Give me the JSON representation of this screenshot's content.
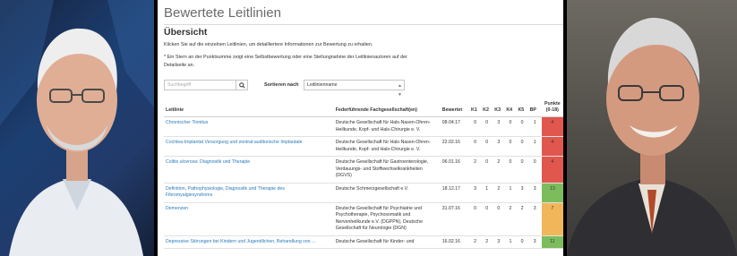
{
  "page": {
    "title": "Bewertete Leitlinien",
    "section_title": "Übersicht",
    "intro": "Klicken Sie auf die einzelnen Leitlinien, um detailliertere Informationen zur Bewertung zu erhalten.",
    "note": "* Ein Stern an der Punktsumme zeigt eine Selbstbewertung oder eine Stellungnahme der Leitlinienautoren auf der Detailseite an."
  },
  "search": {
    "placeholder": "Suchbegriff",
    "button_icon": "search-icon"
  },
  "sort": {
    "label": "Sortieren nach",
    "selected": "Leitlinienname"
  },
  "table": {
    "headers": {
      "leitlinie": "Leitlinie",
      "gesellschaft": "Federführende Fachgesellschaft(en)",
      "bewertet": "Bewertet",
      "k1": "K1",
      "k2": "K2",
      "k3": "K3",
      "k4": "K4",
      "k5": "K5",
      "bp": "BP",
      "punkte": "Punkte",
      "punkte_range": "(0-18)"
    },
    "rows": [
      {
        "title": "Chronischer Tinnitus",
        "society": "Deutsche Gesellschaft für Hals-Nasen-Ohren-Heilkunde, Kopf- und Hals-Chirurgie e. V.",
        "date": "08.04.17",
        "k1": "0",
        "k2": "0",
        "k3": "3",
        "k4": "0",
        "k5": "0",
        "bp": "1",
        "points": "4",
        "color": "#e1574d"
      },
      {
        "title": "Cochlea-Implantat Versorgung und zentral-auditorische Implantate",
        "society": "Deutsche Gesellschaft für Hals-Nasen-Ohren-Heilkunde, Kopf- und Hals-Chirurgie e. V.",
        "date": "22.02.16",
        "k1": "0",
        "k2": "0",
        "k3": "3",
        "k4": "0",
        "k5": "0",
        "bp": "1",
        "points": "4",
        "color": "#e1574d"
      },
      {
        "title": "Colitis ulcerosa: Diagnostik und Therapie",
        "society": "Deutsche Gesellschaft für Gastroenterologie, Verdauungs- und Stoffwechselkrankheiten (DGVS)",
        "date": "06.01.16",
        "k1": "2",
        "k2": "0",
        "k3": "2",
        "k4": "0",
        "k5": "0",
        "bp": "0",
        "points": "4",
        "color": "#e1574d"
      },
      {
        "title": "Definition, Pathophysiologie, Diagnostik und Therapie des Fibromyalgiesyndroms",
        "society": "Deutsche Schmerzgesellschaft e.V.",
        "date": "18.12.17",
        "k1": "3",
        "k2": "1",
        "k3": "2",
        "k4": "1",
        "k5": "3",
        "bp": "3",
        "points": "13",
        "color": "#7cbc5c"
      },
      {
        "title": "Demenzen",
        "society": "Deutsche Gesellschaft für Psychiatrie und Psychotherapie, Psychosomatik und Nervenheilkunde e.V. (DGPPN), Deutsche Gesellschaft für Neurologie (DGN)",
        "date": "31.07.16",
        "k1": "0",
        "k2": "0",
        "k3": "0",
        "k4": "2",
        "k5": "2",
        "bp": "3",
        "points": "7",
        "color": "#f1b65a"
      },
      {
        "title": "Depressive Störungen bei Kindern und Jugendlichen, Behandlung von ...",
        "society": "Deutsche Gesellschaft für Kinder- und",
        "date": "16.02.16",
        "k1": "2",
        "k2": "2",
        "k3": "3",
        "k4": "1",
        "k5": "0",
        "bp": "3",
        "points": "11",
        "color": "#7cbc5c"
      }
    ]
  }
}
